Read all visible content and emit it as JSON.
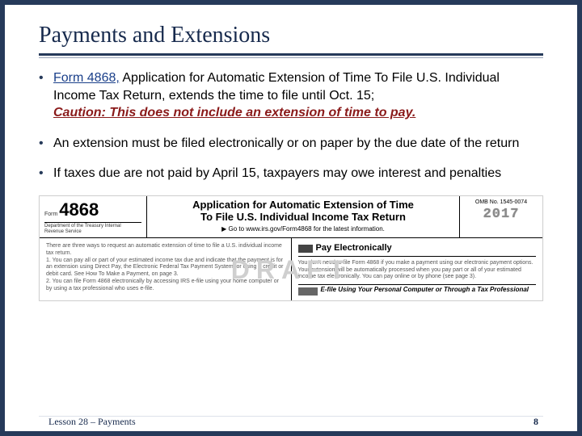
{
  "title": "Payments and Extensions",
  "bullets": {
    "b1_link": "Form 4868,",
    "b1_rest": " Application for Automatic Extension of Time To File U.S. Individual Income Tax Return, extends the time to file until Oct. 15; ",
    "b1_caution": "Caution: This does not include an extension of time to pay.",
    "b2": "An extension must be filed electronically or on paper by the due date of the return",
    "b3": "If taxes due are not paid by April 15, taxpayers may owe interest and penalties"
  },
  "form": {
    "left_label": "Form",
    "number": "4868",
    "dept": "Department of the Treasury\nInternal Revenue Service",
    "title1": "Application for Automatic Extension of Time",
    "title2": "To File U.S. Individual Income Tax Return",
    "goto": "▶ Go to www.irs.gov/Form4868 for the latest information.",
    "omb": "OMB No. 1545-0074",
    "year": "2017",
    "pay_header": "Pay Electronically",
    "left_blurb": "There are three ways to request an automatic extension of time to file a U.S. individual income tax return.\n1. You can pay all or part of your estimated income tax due and indicate that the payment is for an extension using Direct Pay, the Electronic Federal Tax Payment System, or using a credit or debit card. See How To Make a Payment, on page 3.\n2. You can file Form 4868 electronically by accessing IRS e-file using your home computer or by using a tax professional who uses e-file.",
    "right_blurb": "You don't need to file Form 4868 if you make a payment using our electronic payment options. Your extension will be automatically processed when you pay part or all of your estimated income tax electronically. You can pay online or by phone (see page 3).",
    "efile_text": "E-file Using Your Personal Computer or Through a Tax Professional",
    "watermark": "DRAFT"
  },
  "footer": {
    "left": "Lesson 28 – Payments",
    "right": "8"
  }
}
